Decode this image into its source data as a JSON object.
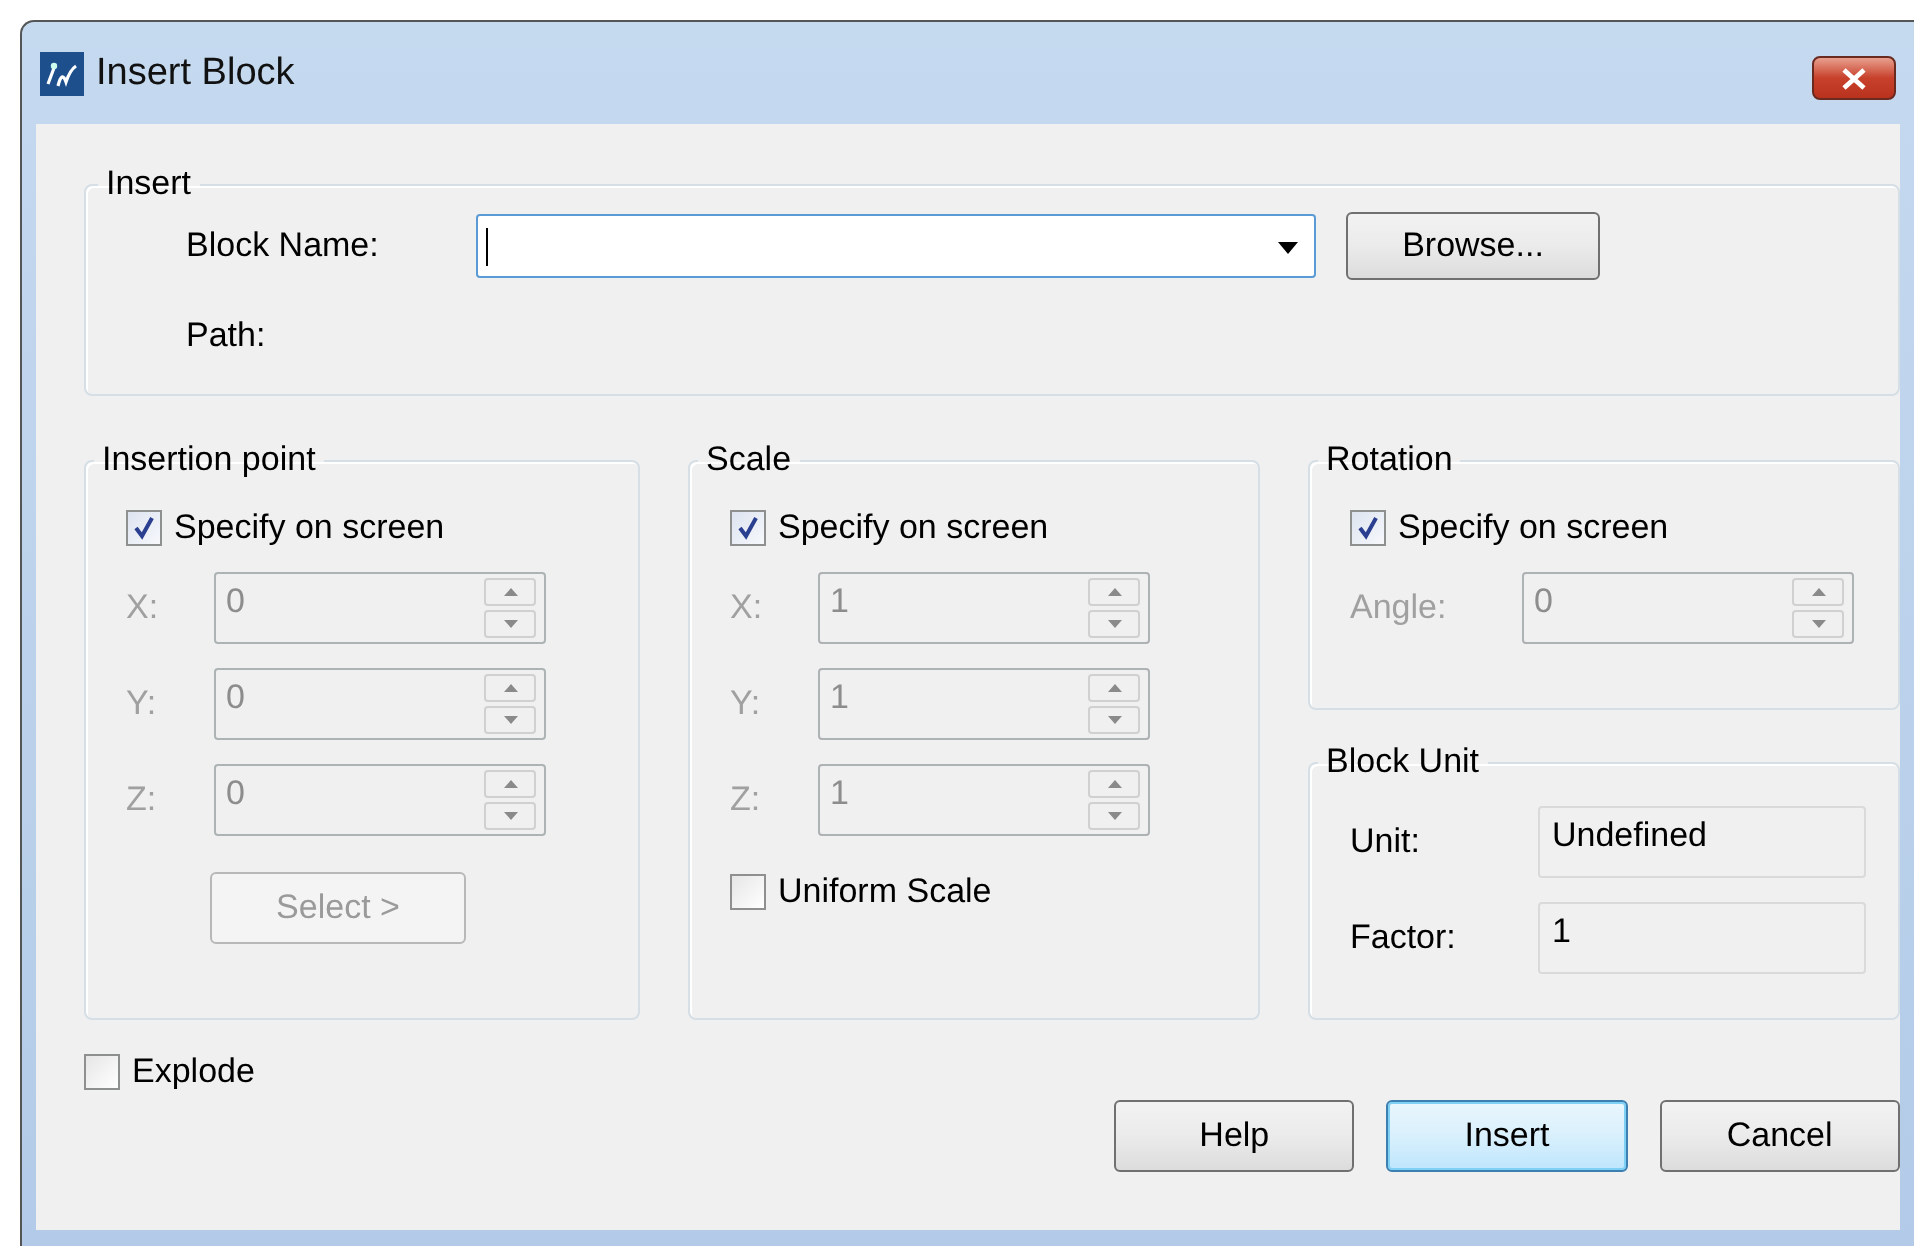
{
  "window": {
    "title": "Insert Block"
  },
  "insert": {
    "title": "Insert",
    "block_name": {
      "label": "Block Name:",
      "focused": true
    },
    "browse_button": "Browse...",
    "path_label": "Path:"
  },
  "insertion_point": {
    "title": "Insertion point",
    "specify": {
      "label": "Specify on screen",
      "checked": true
    },
    "fields": [
      {
        "label": "X:",
        "value": "0",
        "disabled": true
      },
      {
        "label": "Y:",
        "value": "0",
        "disabled": true
      },
      {
        "label": "Z:",
        "value": "0",
        "disabled": true
      }
    ],
    "select_button": {
      "label": "Select >",
      "disabled": true
    }
  },
  "scale": {
    "title": "Scale",
    "specify": {
      "label": "Specify on screen",
      "checked": true
    },
    "fields": [
      {
        "label": "X:",
        "value": "1",
        "disabled": true
      },
      {
        "label": "Y:",
        "value": "1",
        "disabled": true
      },
      {
        "label": "Z:",
        "value": "1",
        "disabled": true
      }
    ],
    "uniform_scale": {
      "label": "Uniform Scale",
      "checked": false
    }
  },
  "rotation": {
    "title": "Rotation",
    "specify": {
      "label": "Specify on screen",
      "checked": true
    },
    "angle": {
      "label": "Angle:",
      "value": "0",
      "disabled": true
    }
  },
  "block_unit": {
    "title": "Block Unit",
    "rows": [
      {
        "label": "Unit:",
        "value": "Undefined"
      },
      {
        "label": "Factor:",
        "value": "1"
      }
    ]
  },
  "explode": {
    "label": "Explode",
    "checked": false
  },
  "buttons": [
    {
      "label": "Help",
      "default": false
    },
    {
      "label": "Insert",
      "default": true
    },
    {
      "label": "Cancel",
      "default": false
    }
  ]
}
